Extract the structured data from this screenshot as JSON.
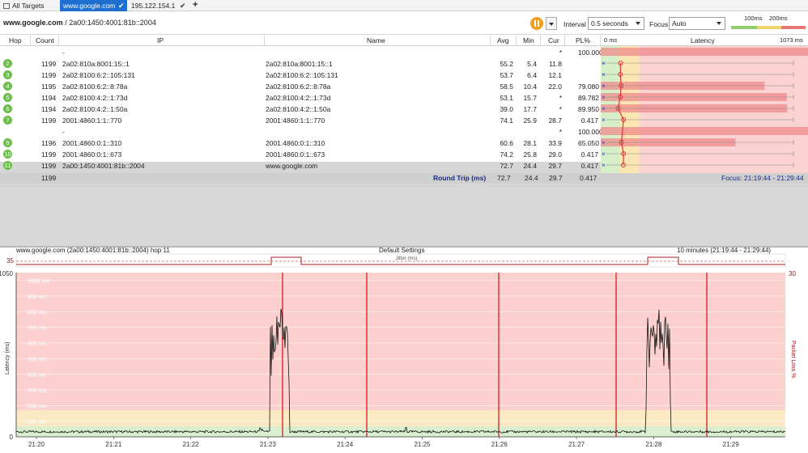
{
  "tabs": [
    {
      "label": "All Targets"
    },
    {
      "label": "www.google.com"
    },
    {
      "label": "195.122.154.1"
    }
  ],
  "toolbar": {
    "target": "www.google.com",
    "sep": "/",
    "target_ip": "2a00:1450:4001:81b::2004",
    "interval_label": "Interval",
    "interval_value": "0.5 seconds",
    "focus_label": "Focus",
    "focus_value": "Auto",
    "legend_100": "100ms",
    "legend_200": "200ms",
    "colors": {
      "green": "#8fd06d",
      "yellow": "#f2d36b",
      "red": "#e77777"
    }
  },
  "table": {
    "columns": [
      "Hop",
      "Count",
      "IP",
      "Name",
      "Avg",
      "Min",
      "Cur",
      "PL%",
      "0 ms",
      "Latency",
      "1073 ms"
    ],
    "rows": [
      {
        "hop": "",
        "count": "",
        "ip": "-",
        "name": "",
        "avg": "",
        "min": "",
        "cur": "*",
        "pl": "100.000"
      },
      {
        "hop": "2",
        "count": "1199",
        "ip": "2a02:810a:8001:15::1",
        "name": "2a02:810a:8001:15::1",
        "avg": "55.2",
        "min": "5.4",
        "cur": "11.8",
        "pl": ""
      },
      {
        "hop": "3",
        "count": "1199",
        "ip": "2a02:8100:6:2::105:131",
        "name": "2a02:8100:6:2::105:131",
        "avg": "53.7",
        "min": "6.4",
        "cur": "12.1",
        "pl": ""
      },
      {
        "hop": "4",
        "count": "1195",
        "ip": "2a02:8100:6:2::8:78a",
        "name": "2a02:8100:6:2::8:78a",
        "avg": "58.5",
        "min": "10.4",
        "cur": "22.0",
        "pl": "79.080"
      },
      {
        "hop": "5",
        "count": "1194",
        "ip": "2a02:8100:4:2::1:73d",
        "name": "2a02:8100:4:2::1:73d",
        "avg": "53.1",
        "min": "15.7",
        "cur": "*",
        "pl": "89.782"
      },
      {
        "hop": "6",
        "count": "1194",
        "ip": "2a02:8100:4:2::1:50a",
        "name": "2a02:8100:4:2::1:50a",
        "avg": "39.0",
        "min": "17.7",
        "cur": "*",
        "pl": "89.950"
      },
      {
        "hop": "7",
        "count": "1199",
        "ip": "2001:4860:1:1::770",
        "name": "2001:4860:1:1::770",
        "avg": "74.1",
        "min": "25.9",
        "cur": "28.7",
        "pl": "0.417"
      },
      {
        "hop": "",
        "count": "",
        "ip": "-",
        "name": "",
        "avg": "",
        "min": "",
        "cur": "*",
        "pl": "100.000"
      },
      {
        "hop": "9",
        "count": "1196",
        "ip": "2001:4860:0:1::310",
        "name": "2001:4860:0:1::310",
        "avg": "60.6",
        "min": "28.1",
        "cur": "33.9",
        "pl": "65.050"
      },
      {
        "hop": "10",
        "count": "1199",
        "ip": "2001:4860:0:1::673",
        "name": "2001:4860:0:1::673",
        "avg": "74.2",
        "min": "25.8",
        "cur": "29.0",
        "pl": "0.417"
      },
      {
        "hop": "11",
        "count": "1199",
        "ip": "2a00:1450:4001:81b::2004",
        "name": "www.google.com",
        "avg": "72.7",
        "min": "24.4",
        "cur": "29.7",
        "pl": "0.417"
      }
    ],
    "summary": {
      "count": "1199",
      "label": "Round Trip (ms)",
      "avg": "72.7",
      "min": "24.4",
      "cur": "29.7",
      "pl": "0.417",
      "focus": "Focus: 21:19:44 - 21:29:44"
    }
  },
  "graph": {
    "header_left": "www.google.com (2a00:1450:4001:81b::2004) hop 11",
    "header_center": "Default Settings",
    "header_right": "10 minutes (21:19:44 - 21:29:44)",
    "jitter_label": "Jitter (ms)",
    "jitter_max": "35",
    "y_max": "1050",
    "y_min": "0",
    "y_right_max": "30",
    "y_axis_label": "Latency (ms)",
    "y_right_label": "Packet Loss %",
    "grid_labels": [
      "1000 ms",
      "900 ms",
      "800 ms",
      "700 ms",
      "600 ms",
      "500 ms",
      "400 ms",
      "300 ms",
      "200 ms",
      "100 ms"
    ],
    "x_ticks": [
      "21:20",
      "21:21",
      "21:22",
      "21:23",
      "21:24",
      "21:25",
      "21:26",
      "21:27",
      "21:28",
      "21:29"
    ]
  }
}
